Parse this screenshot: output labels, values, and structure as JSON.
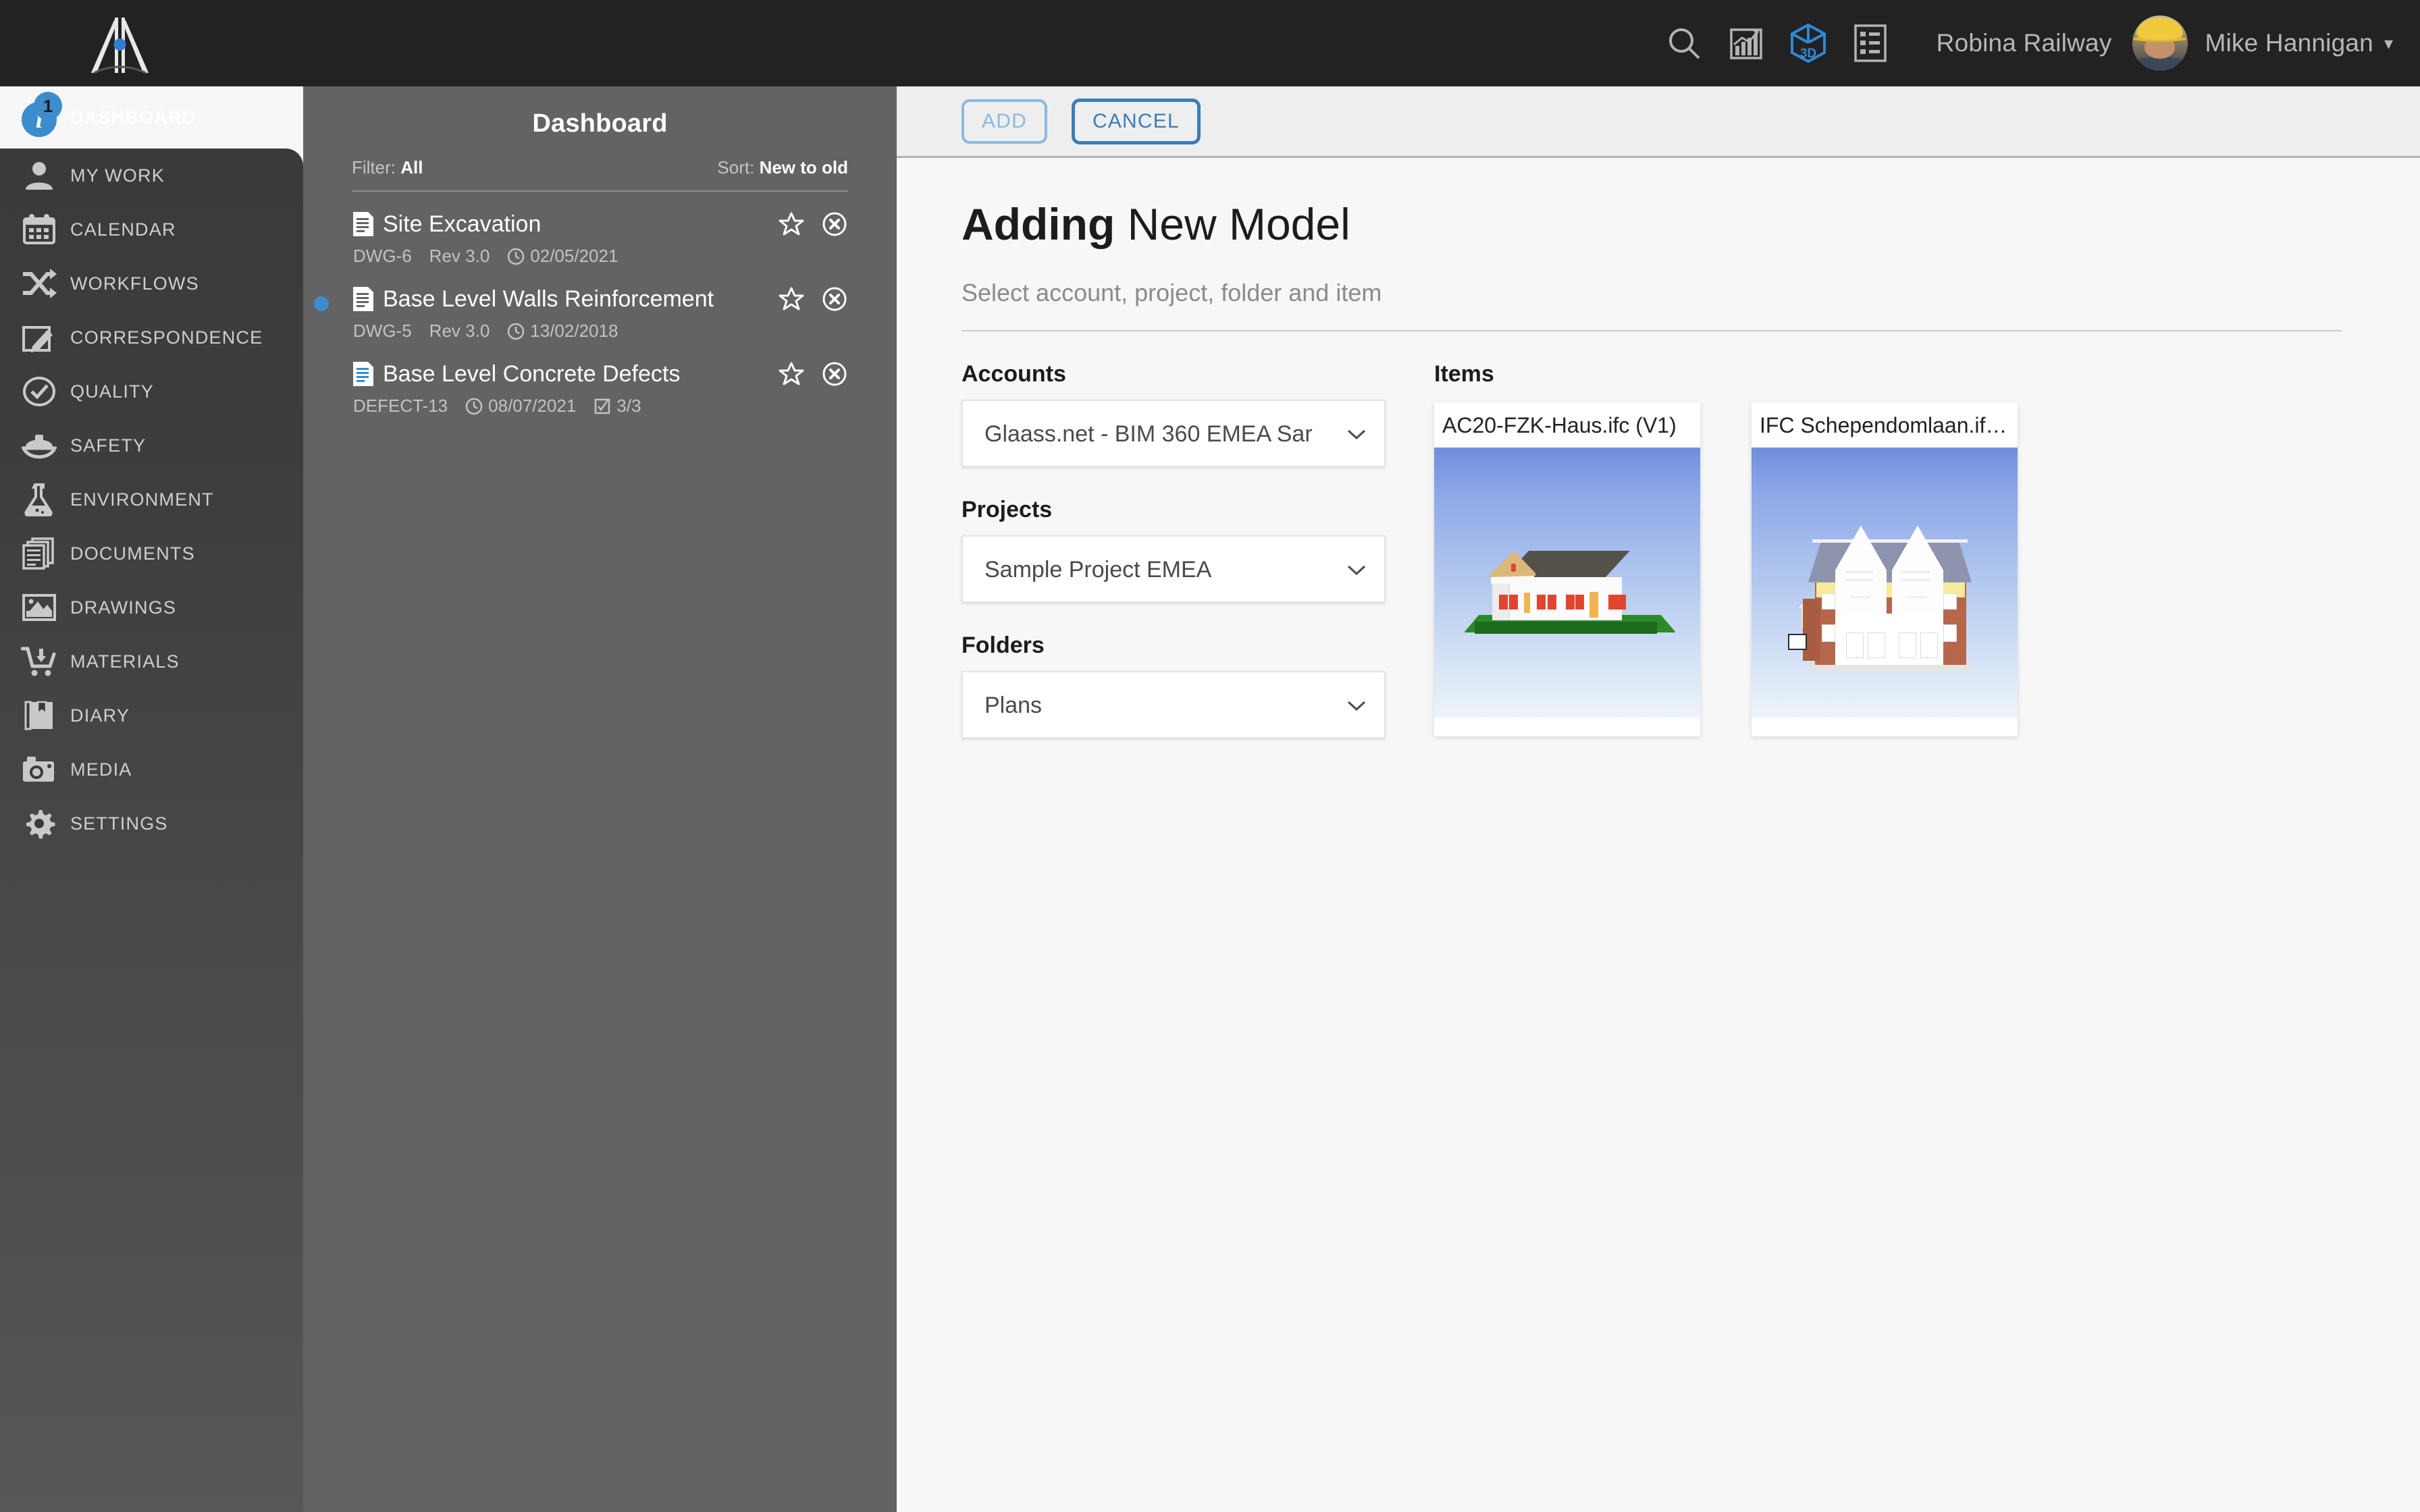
{
  "header": {
    "logo_name": "bridge-logo",
    "icons": [
      {
        "name": "search-icon",
        "label": "Search"
      },
      {
        "name": "analytics-icon",
        "label": "Analytics"
      },
      {
        "name": "three-d-icon",
        "label": "3D"
      },
      {
        "name": "list-icon",
        "label": "List"
      }
    ],
    "project_name": "Robina Railway",
    "user_name": "Mike Hannigan",
    "caret": "▾",
    "accent_blue": "#3c8dcd",
    "bar_color": "#222222"
  },
  "sidebar": {
    "dashboard": {
      "label": "DASHBOARD",
      "badge": "1",
      "icon_letter": "i"
    },
    "items": [
      {
        "label": "MY WORK",
        "icon": "person-icon"
      },
      {
        "label": "CALENDAR",
        "icon": "calendar-icon"
      },
      {
        "label": "WORKFLOWS",
        "icon": "shuffle-icon"
      },
      {
        "label": "CORRESPONDENCE",
        "icon": "edit-note-icon"
      },
      {
        "label": "QUALITY",
        "icon": "check-circle-icon"
      },
      {
        "label": "SAFETY",
        "icon": "hard-hat-icon"
      },
      {
        "label": "ENVIRONMENT",
        "icon": "flask-icon"
      },
      {
        "label": "DOCUMENTS",
        "icon": "documents-icon"
      },
      {
        "label": "DRAWINGS",
        "icon": "image-icon"
      },
      {
        "label": "MATERIALS",
        "icon": "cart-icon"
      },
      {
        "label": "DIARY",
        "icon": "book-icon"
      },
      {
        "label": "MEDIA",
        "icon": "camera-icon"
      },
      {
        "label": "SETTINGS",
        "icon": "gear-icon"
      }
    ]
  },
  "dashboard_panel": {
    "title": "Dashboard",
    "filter_label": "Filter:",
    "filter_value": "All",
    "sort_label": "Sort:",
    "sort_value": "New to old",
    "documents": [
      {
        "title": "Site Excavation",
        "ref": "DWG-6",
        "revision": "Rev 3.0",
        "date": "02/05/2021",
        "checklist": "",
        "selected": false,
        "file_icon": "document-white-icon"
      },
      {
        "title": "Base Level Walls Reinforcement",
        "ref": "DWG-5",
        "revision": "Rev 3.0",
        "date": "13/02/2018",
        "checklist": "",
        "selected": true,
        "file_icon": "document-white-icon"
      },
      {
        "title": "Base Level Concrete Defects",
        "ref": "DEFECT-13",
        "revision": "",
        "date": "08/07/2021",
        "checklist": "3/3",
        "selected": false,
        "file_icon": "document-blue-icon"
      }
    ]
  },
  "main": {
    "toolbar": {
      "add_label": "ADD",
      "add_disabled": true,
      "cancel_label": "CANCEL"
    },
    "title_bold": "Adding",
    "title_rest": " New Model",
    "subtitle": "Select account, project, folder and item",
    "fields": [
      {
        "label": "Accounts",
        "value": "Glaass.net - BIM 360 EMEA Sar"
      },
      {
        "label": "Projects",
        "value": "Sample Project EMEA"
      },
      {
        "label": "Folders",
        "value": "Plans"
      }
    ],
    "items_heading": "Items",
    "items": [
      {
        "label": "AC20-FZK-Haus.ifc (V1)",
        "thumb": "single-storey-house"
      },
      {
        "label": "IFC Schependomlaan.if…",
        "thumb": "brick-townhouse"
      }
    ]
  }
}
